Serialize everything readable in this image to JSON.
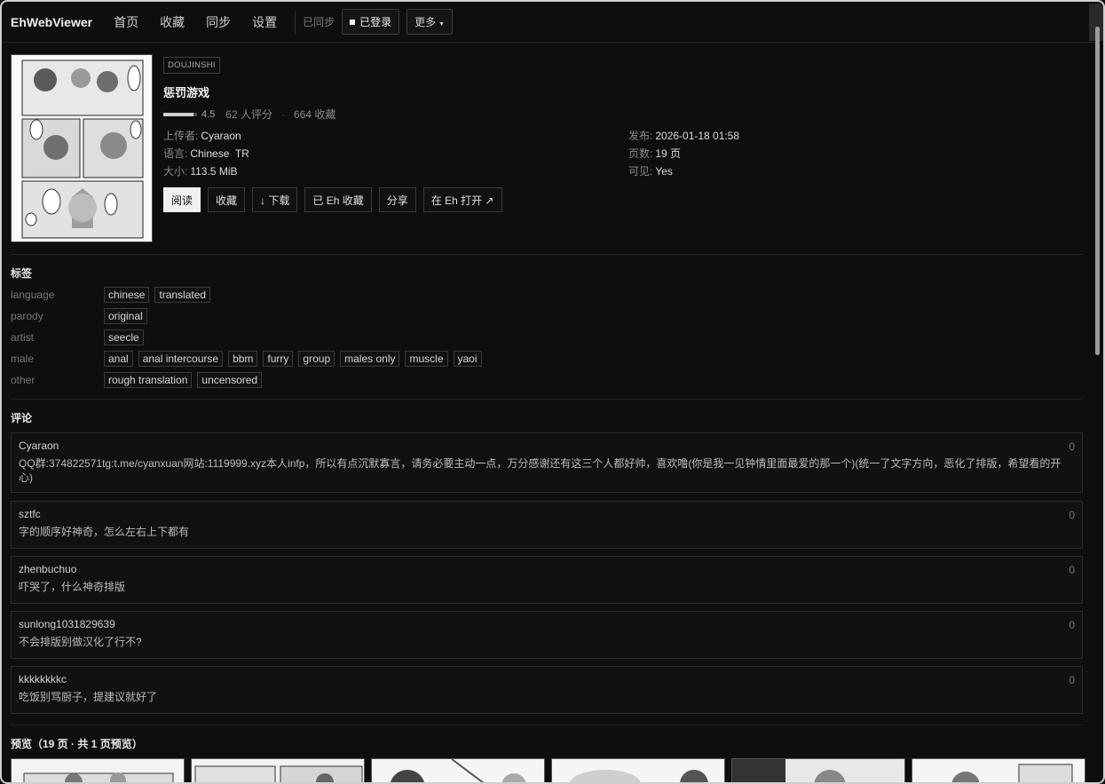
{
  "nav": {
    "brand": "EhWebViewer",
    "links": [
      "首页",
      "收藏",
      "同步",
      "设置"
    ],
    "sync_status": "已同步",
    "login_label": "已登录",
    "more_label": "更多"
  },
  "gallery": {
    "category": "DOUJINSHI",
    "title": "惩罚游戏",
    "rating": 4.5,
    "rating_label": "4.5",
    "rating_count": "62 人评分",
    "favorites": "664 收藏",
    "uploader_label": "上传者:",
    "uploader": "Cyaraon",
    "language_label": "语言:",
    "language": "Chinese  TR",
    "size_label": "大小:",
    "size": "113.5 MiB",
    "posted_label": "发布:",
    "posted": "2026-01-18 01:58",
    "pages_label": "页数:",
    "pages": "19 页",
    "visible_label": "可见:",
    "visible": "Yes"
  },
  "actions": {
    "read": "阅读",
    "favorite": "收藏",
    "download": "↓ 下载",
    "eh_favorited": "已 Eh 收藏",
    "share": "分享",
    "open_eh": "在 Eh 打开 ↗"
  },
  "tags": {
    "title": "标签",
    "groups": [
      {
        "ns": "language",
        "tags": [
          "chinese",
          "translated"
        ]
      },
      {
        "ns": "parody",
        "tags": [
          "original"
        ]
      },
      {
        "ns": "artist",
        "tags": [
          "seecle"
        ]
      },
      {
        "ns": "male",
        "tags": [
          "anal",
          "anal intercourse",
          "bbm",
          "furry",
          "group",
          "males only",
          "muscle",
          "yaoi"
        ]
      },
      {
        "ns": "other",
        "tags": [
          "rough translation",
          "uncensored"
        ]
      }
    ]
  },
  "comments": {
    "title": "评论",
    "items": [
      {
        "author": "Cyaraon",
        "score": "0",
        "body": "QQ群:374822571tg:t.me/cyanxuan网站:1119999.xyz本人infp，所以有点沉默寡言，请务必要主动一点，万分感谢还有这三个人都好帅，喜欢噜(你是我一见钟情里面最爱的那一个)(统一了文字方向，恶化了排版，希望看的开心)"
      },
      {
        "author": "sztfc",
        "score": "0",
        "body": "字的顺序好神奇，怎么左右上下都有"
      },
      {
        "author": "zhenbuchuo",
        "score": "0",
        "body": "吓哭了，什么神奇排版"
      },
      {
        "author": "sunlong1031829639",
        "score": "0",
        "body": "不会排版别做汉化了行不?"
      },
      {
        "author": "kkkkkkkkc",
        "score": "0",
        "body": "吃饭别骂厨子，提建议就好了"
      }
    ]
  },
  "preview": {
    "title": "预览（19 页 · 共 1 页预览）",
    "thumb_count": 6
  },
  "colors": {
    "background": "#0e0e0e",
    "accent_button": "#f0f0f0",
    "border": "#3a3a3a"
  }
}
